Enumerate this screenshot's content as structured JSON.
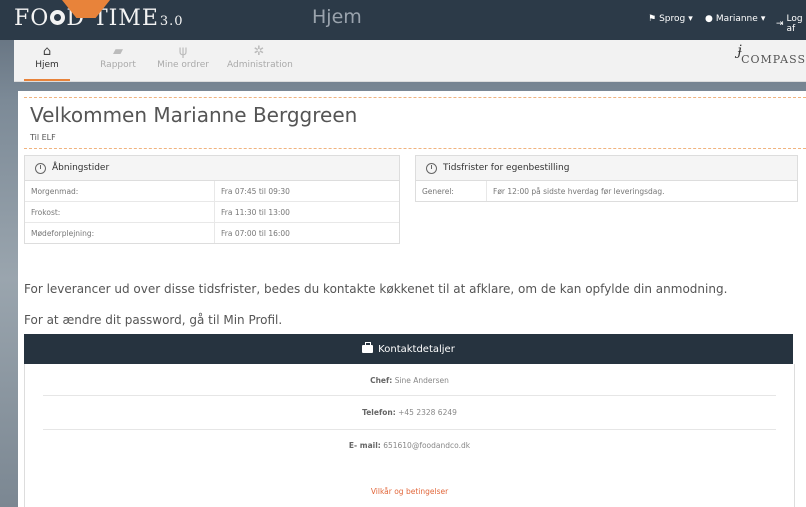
{
  "app": {
    "logo_text": "FO",
    "logo_text2": "D TIME",
    "logo_version": "3.0",
    "page_title": "Hjem"
  },
  "top_menu": {
    "language": "Sprog",
    "user": "Marianne",
    "logout": "Log af"
  },
  "nav": [
    {
      "label": "Hjem",
      "icon": "home-icon",
      "active": true
    },
    {
      "label": "Rapport",
      "icon": "briefcase-icon",
      "active": false
    },
    {
      "label": "Mine ordrer",
      "icon": "cutlery-icon",
      "active": false
    },
    {
      "label": "Administration",
      "icon": "gear-icon",
      "active": false
    }
  ],
  "brand": {
    "partner_logo": "COMPASS"
  },
  "welcome": {
    "title": "Velkommen Marianne Berggreen",
    "subtitle": "Til ELF"
  },
  "opening_hours": {
    "title": "Åbningstider",
    "rows": [
      {
        "meal": "Morgenmad:",
        "time": "Fra 07:45 til 09:30"
      },
      {
        "meal": "Frokost:",
        "time": "Fra 11:30 til 13:00"
      },
      {
        "meal": "Mødeforplejning:",
        "time": "Fra 07:00 til 16:00"
      }
    ]
  },
  "deadlines": {
    "title": "Tidsfrister for egenbestilling",
    "rows": [
      {
        "label": "Generel:",
        "text": "Før 12:00 på sidste hverdag før leveringsdag."
      }
    ]
  },
  "info_text_1": "For leverancer ud over disse tidsfrister, bedes du kontakte køkkenet til at afklare, om de kan opfylde din anmodning.",
  "info_text_2": "For at ændre dit password, gå til Min Profil.",
  "contact": {
    "title": "Kontaktdetaljer",
    "chef_label": "Chef:",
    "chef_value": "Sine Andersen",
    "phone_label": "Telefon:",
    "phone_value": "+45 2328 6249",
    "email_label": "E- mail:",
    "email_value": "651610@foodandco.dk"
  },
  "footer": {
    "terms_link": "Vilkår og betingelser"
  },
  "colors": {
    "accent": "#e8833a",
    "header_bg": "#2c3a48",
    "contact_bg": "#26333f",
    "link": "#e2683c"
  }
}
